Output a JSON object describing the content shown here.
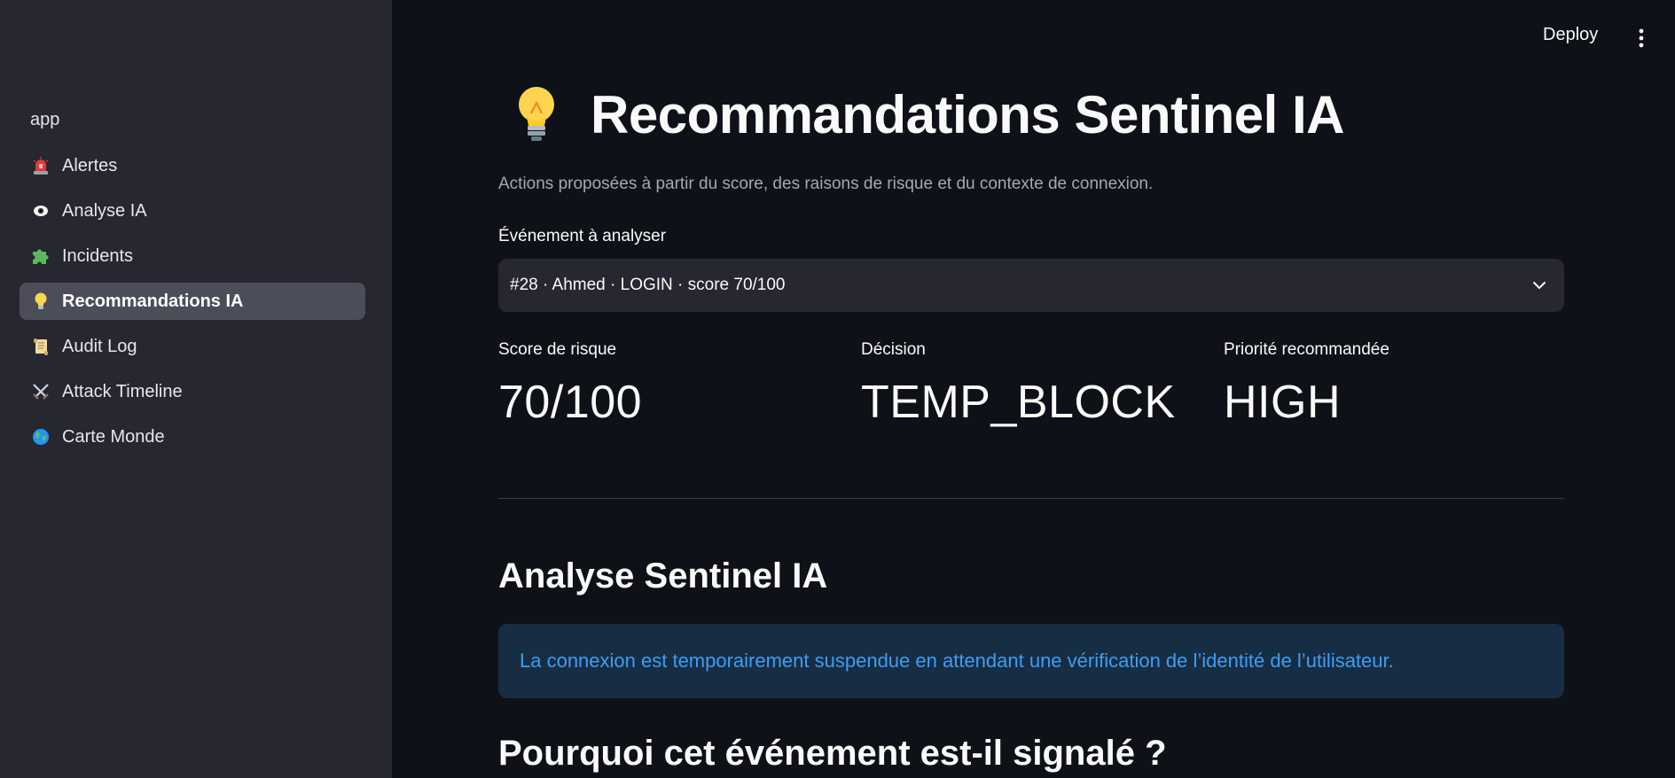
{
  "sidebar": {
    "app_label": "app",
    "items": [
      {
        "label": "Alertes",
        "icon": "siren-icon",
        "active": false
      },
      {
        "label": "Analyse IA",
        "icon": "eye-icon",
        "active": false
      },
      {
        "label": "Incidents",
        "icon": "puzzle-icon",
        "active": false
      },
      {
        "label": "Recommandations IA",
        "icon": "lightbulb-icon",
        "active": true
      },
      {
        "label": "Audit Log",
        "icon": "scroll-icon",
        "active": false
      },
      {
        "label": "Attack Timeline",
        "icon": "crossed-swords-icon",
        "active": false
      },
      {
        "label": "Carte Monde",
        "icon": "globe-icon",
        "active": false
      }
    ]
  },
  "header": {
    "deploy_label": "Deploy",
    "menu_icon": "kebab-menu-icon"
  },
  "main": {
    "title": "Recommandations Sentinel IA",
    "title_icon": "lightbulb-icon",
    "subtitle": "Actions proposées à partir du score, des raisons de risque et du contexte de connexion.",
    "select_label": "Événement à analyser",
    "select_value": "#28 · Ahmed · LOGIN · score 70/100",
    "metrics": [
      {
        "label": "Score de risque",
        "value": "70/100"
      },
      {
        "label": "Décision",
        "value": "TEMP_BLOCK"
      },
      {
        "label": "Priorité recommandée",
        "value": "HIGH"
      }
    ],
    "analysis_heading": "Analyse Sentinel IA",
    "analysis_info": "La connexion est temporairement suspendue en attendant une vérification de l’identité de l’utilisateur.",
    "why_heading": "Pourquoi cet événement est-il signalé ?"
  },
  "colors": {
    "background": "#0e1117",
    "sidebar": "#262730",
    "active_item": "#4b4d59",
    "info_bg": "#172d43",
    "info_text": "#3d9df3"
  }
}
